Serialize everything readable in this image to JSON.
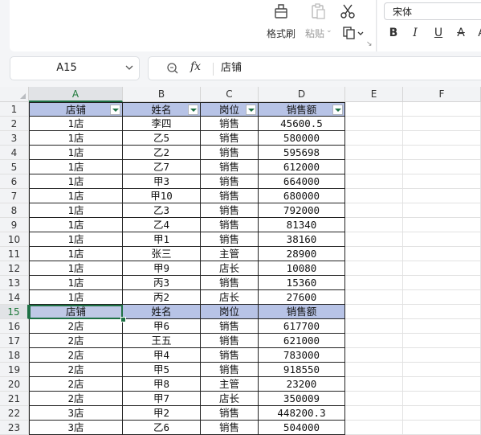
{
  "ribbon": {
    "format_painter": "格式刷",
    "paste": "粘贴",
    "font_name": "宋体",
    "fmt_buttons": [
      "B",
      "I",
      "U",
      "A",
      "A"
    ]
  },
  "formula_bar": {
    "cell_ref": "A15",
    "fx": "fx",
    "content": "店铺"
  },
  "columns": [
    "A",
    "B",
    "C",
    "D",
    "E",
    "F"
  ],
  "rows": [
    [
      "店铺",
      "姓名",
      "岗位",
      "销售额"
    ],
    [
      "1店",
      "李四",
      "销售",
      "45600.5"
    ],
    [
      "1店",
      "乙5",
      "销售",
      "580000"
    ],
    [
      "1店",
      "乙2",
      "销售",
      "595698"
    ],
    [
      "1店",
      "乙7",
      "销售",
      "612000"
    ],
    [
      "1店",
      "甲3",
      "销售",
      "664000"
    ],
    [
      "1店",
      "甲10",
      "销售",
      "680000"
    ],
    [
      "1店",
      "乙3",
      "销售",
      "792000"
    ],
    [
      "1店",
      "乙4",
      "销售",
      "81340"
    ],
    [
      "1店",
      "甲1",
      "销售",
      "38160"
    ],
    [
      "1店",
      "张三",
      "主管",
      "28900"
    ],
    [
      "1店",
      "甲9",
      "店长",
      "10080"
    ],
    [
      "1店",
      "丙3",
      "销售",
      "15360"
    ],
    [
      "1店",
      "丙2",
      "店长",
      "27600"
    ],
    [
      "店铺",
      "姓名",
      "岗位",
      "销售额"
    ],
    [
      "2店",
      "甲6",
      "销售",
      "617700"
    ],
    [
      "2店",
      "王五",
      "销售",
      "621000"
    ],
    [
      "2店",
      "甲4",
      "销售",
      "783000"
    ],
    [
      "2店",
      "甲5",
      "销售",
      "918550"
    ],
    [
      "2店",
      "甲8",
      "主管",
      "23200"
    ],
    [
      "2店",
      "甲7",
      "店长",
      "350009"
    ],
    [
      "3店",
      "甲2",
      "销售",
      "448200.3"
    ],
    [
      "3店",
      "乙6",
      "销售",
      "504000"
    ]
  ],
  "active_cell": "A15",
  "colors": {
    "header_fill": "#b7c3e6",
    "selection": "#1e7145"
  }
}
